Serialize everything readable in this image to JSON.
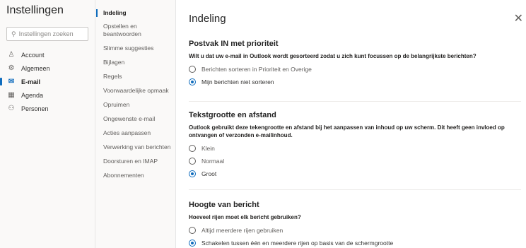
{
  "left": {
    "title": "Instellingen",
    "search_placeholder": "Instellingen zoeken",
    "items": [
      {
        "label": "Account",
        "icon": "person-icon"
      },
      {
        "label": "Algemeen",
        "icon": "gear-icon"
      },
      {
        "label": "E-mail",
        "icon": "mail-icon",
        "active": true
      },
      {
        "label": "Agenda",
        "icon": "calendar-icon"
      },
      {
        "label": "Personen",
        "icon": "people-icon"
      }
    ]
  },
  "middle": {
    "items": [
      {
        "label": "Indeling",
        "active": true
      },
      {
        "label": "Opstellen en beantwoorden"
      },
      {
        "label": "Slimme suggesties"
      },
      {
        "label": "Bijlagen"
      },
      {
        "label": "Regels"
      },
      {
        "label": "Voorwaardelijke opmaak"
      },
      {
        "label": "Opruimen"
      },
      {
        "label": "Ongewenste e-mail"
      },
      {
        "label": "Acties aanpassen"
      },
      {
        "label": "Verwerking van berichten"
      },
      {
        "label": "Doorsturen en IMAP"
      },
      {
        "label": "Abonnementen"
      }
    ]
  },
  "content": {
    "title": "Indeling",
    "close_label": "✕",
    "sections": [
      {
        "title": "Postvak IN met prioriteit",
        "desc": "Wilt u dat uw e-mail in Outlook wordt gesorteerd zodat u zich kunt focussen op de belangrijkste berichten?",
        "options": [
          "Berichten sorteren in Prioriteit en Overige",
          "Mijn berichten niet sorteren"
        ],
        "selected": 1
      },
      {
        "title": "Tekstgrootte en afstand",
        "desc": "Outlook gebruikt deze tekengrootte en afstand bij het aanpassen van inhoud op uw scherm. Dit heeft geen invloed op ontvangen of verzonden e-mailinhoud.",
        "options": [
          "Klein",
          "Normaal",
          "Groot"
        ],
        "selected": 2
      },
      {
        "title": "Hoogte van bericht",
        "desc": "Hoeveel rijen moet elk bericht gebruiken?",
        "options": [
          "Altijd meerdere rijen gebruiken",
          "Schakelen tussen één en meerdere rijen op basis van de schermgrootte"
        ],
        "selected": 1
      }
    ]
  }
}
